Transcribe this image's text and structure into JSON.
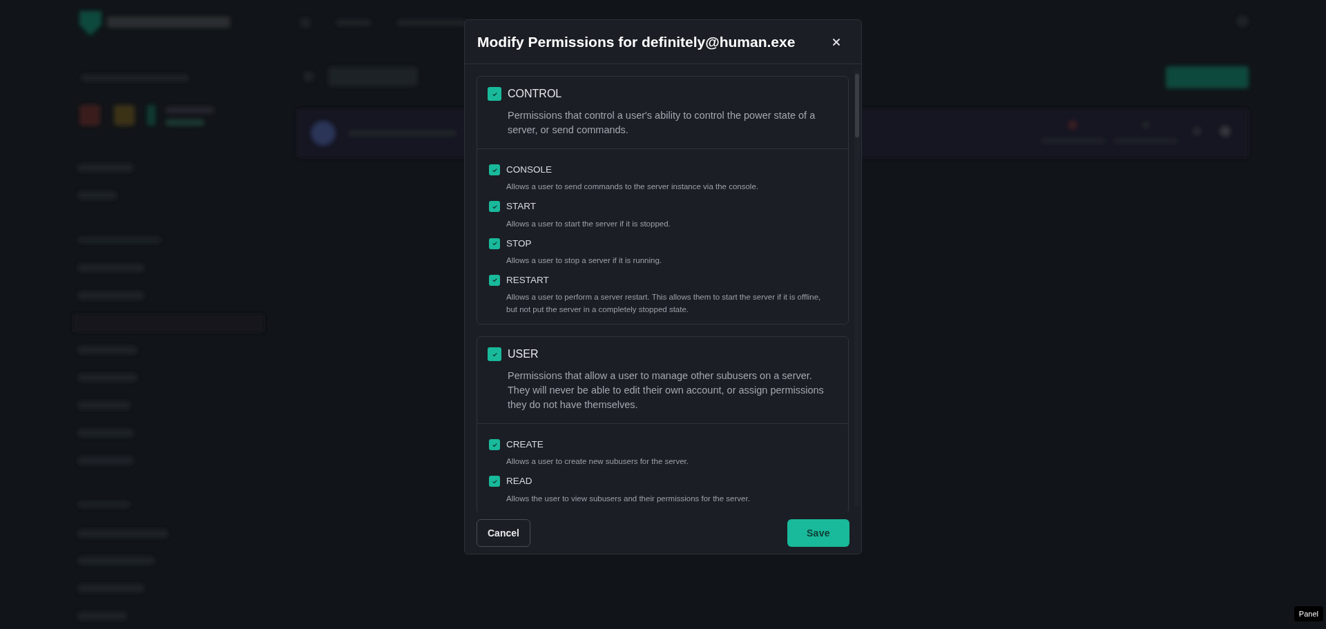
{
  "dialog": {
    "title": "Modify Permissions for definitely@human.exe",
    "groups": [
      {
        "name": "CONTROL",
        "checked": true,
        "description": "Permissions that control a user's ability to control the power state of a server, or send commands.",
        "permissions": [
          {
            "name": "CONSOLE",
            "checked": true,
            "description": "Allows a user to send commands to the server instance via the console."
          },
          {
            "name": "START",
            "checked": true,
            "description": "Allows a user to start the server if it is stopped."
          },
          {
            "name": "STOP",
            "checked": true,
            "description": "Allows a user to stop a server if it is running."
          },
          {
            "name": "RESTART",
            "checked": true,
            "description": "Allows a user to perform a server restart. This allows them to start the server if it is offline, but not put the server in a completely stopped state."
          }
        ]
      },
      {
        "name": "USER",
        "checked": true,
        "description": "Permissions that allow a user to manage other subusers on a server. They will never be able to edit their own account, or assign permissions they do not have themselves.",
        "permissions": [
          {
            "name": "CREATE",
            "checked": true,
            "description": "Allows a user to create new subusers for the server."
          },
          {
            "name": "READ",
            "checked": true,
            "description": "Allows the user to view subusers and their permissions for the server."
          }
        ]
      }
    ],
    "buttons": [
      {
        "kind": "secondary",
        "label": "Cancel"
      },
      {
        "kind": "primary",
        "label": "Save"
      }
    ]
  },
  "corner_badge": "Panel"
}
